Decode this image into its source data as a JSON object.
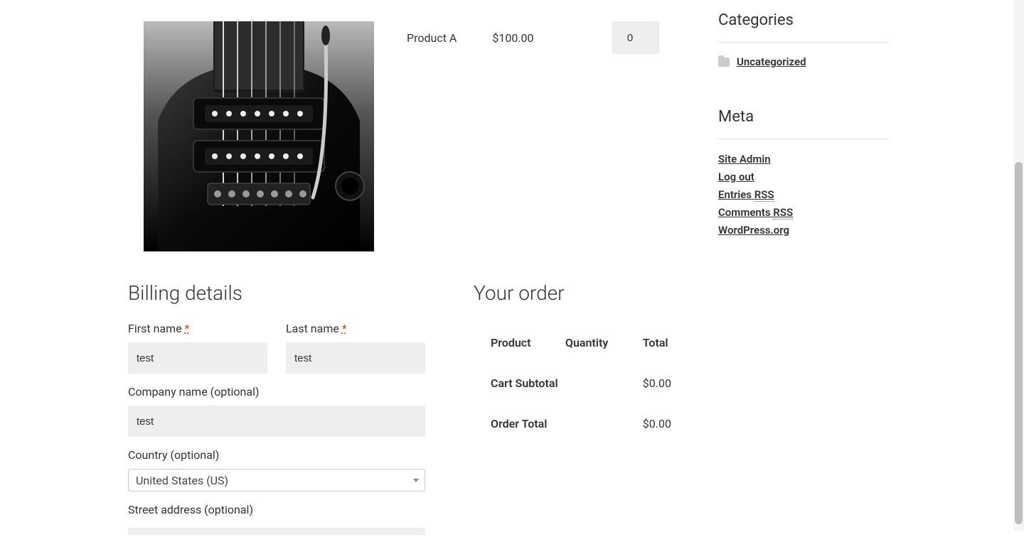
{
  "product": {
    "name": "Product A",
    "price": "$100.00",
    "qty": "0"
  },
  "billing": {
    "title": "Billing details",
    "first_name_label": "First name",
    "first_name_value": "test",
    "last_name_label": "Last name",
    "last_name_value": "test",
    "company_label": "Company name (optional)",
    "company_value": "test",
    "country_label": "Country (optional)",
    "country_value": "United States (US)",
    "street_label": "Street address (optional)",
    "required_mark": "*"
  },
  "order": {
    "title": "Your order",
    "th_product": "Product",
    "th_quantity": "Quantity",
    "th_total": "Total",
    "subtotal_label": "Cart Subtotal",
    "subtotal_value": "$0.00",
    "total_label": "Order Total",
    "total_value": "$0.00"
  },
  "sidebar": {
    "categories_title": "Categories",
    "category_item": "Uncategorized",
    "meta_title": "Meta",
    "meta_links": {
      "site_admin": "Site Admin",
      "logout": "Log out",
      "entries_pre": "Entries ",
      "entries_rss": "RSS",
      "comments_pre": "Comments ",
      "comments_rss": "RSS",
      "wporg": "WordPress.org"
    }
  }
}
